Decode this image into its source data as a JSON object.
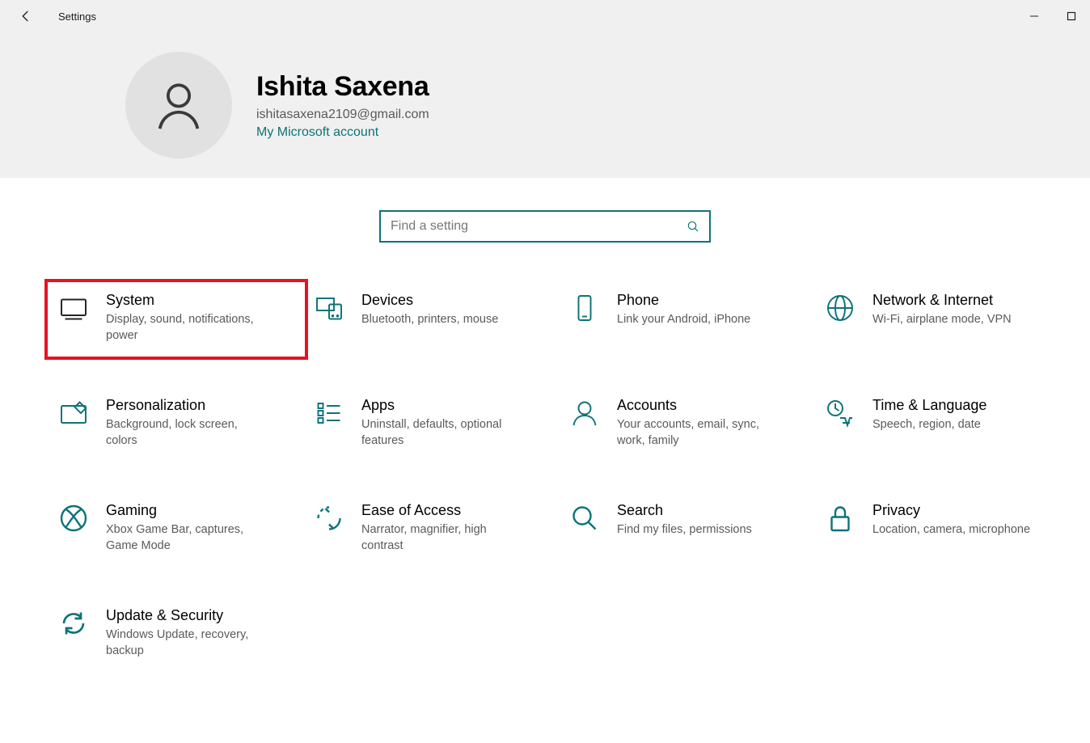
{
  "window": {
    "title": "Settings"
  },
  "user": {
    "name": "Ishita Saxena",
    "email": "ishitasaxena2109@gmail.com",
    "account_link": "My Microsoft account"
  },
  "search": {
    "placeholder": "Find a setting"
  },
  "tiles": {
    "system": {
      "title": "System",
      "desc": "Display, sound, notifications, power"
    },
    "devices": {
      "title": "Devices",
      "desc": "Bluetooth, printers, mouse"
    },
    "phone": {
      "title": "Phone",
      "desc": "Link your Android, iPhone"
    },
    "network": {
      "title": "Network & Internet",
      "desc": "Wi-Fi, airplane mode, VPN"
    },
    "personalization": {
      "title": "Personalization",
      "desc": "Background, lock screen, colors"
    },
    "apps": {
      "title": "Apps",
      "desc": "Uninstall, defaults, optional features"
    },
    "accounts": {
      "title": "Accounts",
      "desc": "Your accounts, email, sync, work, family"
    },
    "timelang": {
      "title": "Time & Language",
      "desc": "Speech, region, date"
    },
    "gaming": {
      "title": "Gaming",
      "desc": "Xbox Game Bar, captures, Game Mode"
    },
    "easeofaccess": {
      "title": "Ease of Access",
      "desc": "Narrator, magnifier, high contrast"
    },
    "search_tile": {
      "title": "Search",
      "desc": "Find my files, permissions"
    },
    "privacy": {
      "title": "Privacy",
      "desc": "Location, camera, microphone"
    },
    "update": {
      "title": "Update & Security",
      "desc": "Windows Update, recovery, backup"
    }
  },
  "highlight": "system",
  "colors": {
    "accent": "#0d7377",
    "highlight_border": "#e81123",
    "muted": "#5a5a5a",
    "top_bg": "#f0f0f0"
  }
}
